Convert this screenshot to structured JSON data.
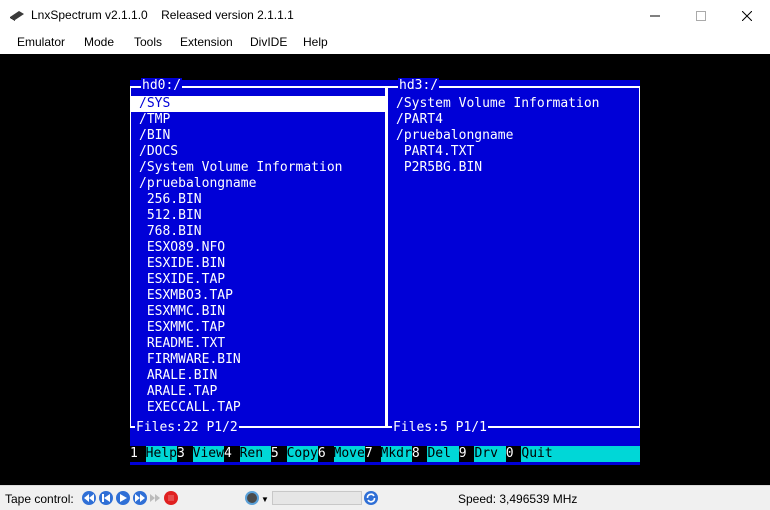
{
  "window": {
    "title": "LnxSpectrum v2.1.1.0    Released version 2.1.1.1"
  },
  "menu": [
    "Emulator",
    "Mode",
    "Tools",
    "Extension",
    "DivIDE",
    "Help"
  ],
  "left_panel": {
    "title": "hd0:/",
    "files": [
      "/SYS",
      "/TMP",
      "/BIN",
      "/DOCS",
      "/System Volume Information",
      "/pruebalongname",
      " 256.BIN",
      " 512.BIN",
      " 768.BIN",
      " ESXO89.NFO",
      " ESXIDE.BIN",
      " ESXIDE.TAP",
      " ESXMBO3.TAP",
      " ESXMMC.BIN",
      " ESXMMC.TAP",
      " README.TXT",
      " FIRMWARE.BIN",
      " ARALE.BIN",
      " ARALE.TAP",
      " EXECCALL.TAP"
    ],
    "selected_index": 0,
    "footer": "Files:22 P1/2"
  },
  "right_panel": {
    "title": "hd3:/",
    "files": [
      "/System Volume Information",
      "/PART4",
      "/pruebalongname",
      " PART4.TXT",
      " P2R5BG.BIN"
    ],
    "footer": "Files:5 P1/1"
  },
  "function_keys": [
    {
      "num": "1 ",
      "label": "Help"
    },
    {
      "num": "3 ",
      "label": "View"
    },
    {
      "num": "4 ",
      "label": "Ren "
    },
    {
      "num": "5 ",
      "label": "Copy"
    },
    {
      "num": "6 ",
      "label": "Move"
    },
    {
      "num": "7 ",
      "label": "Mkdr"
    },
    {
      "num": "8 ",
      "label": "Del "
    },
    {
      "num": "9 ",
      "label": "Drv "
    },
    {
      "num": "0 ",
      "label": "Quit"
    }
  ],
  "statusbar": {
    "tape_label": "Tape control:",
    "speed": "Speed: 3,496539 MHz"
  },
  "colors": {
    "screen_blue": "#0000d7",
    "fkey_cyan": "#00d7d7",
    "tape_blue": "#2f6fd6",
    "record_red": "#e02020"
  }
}
